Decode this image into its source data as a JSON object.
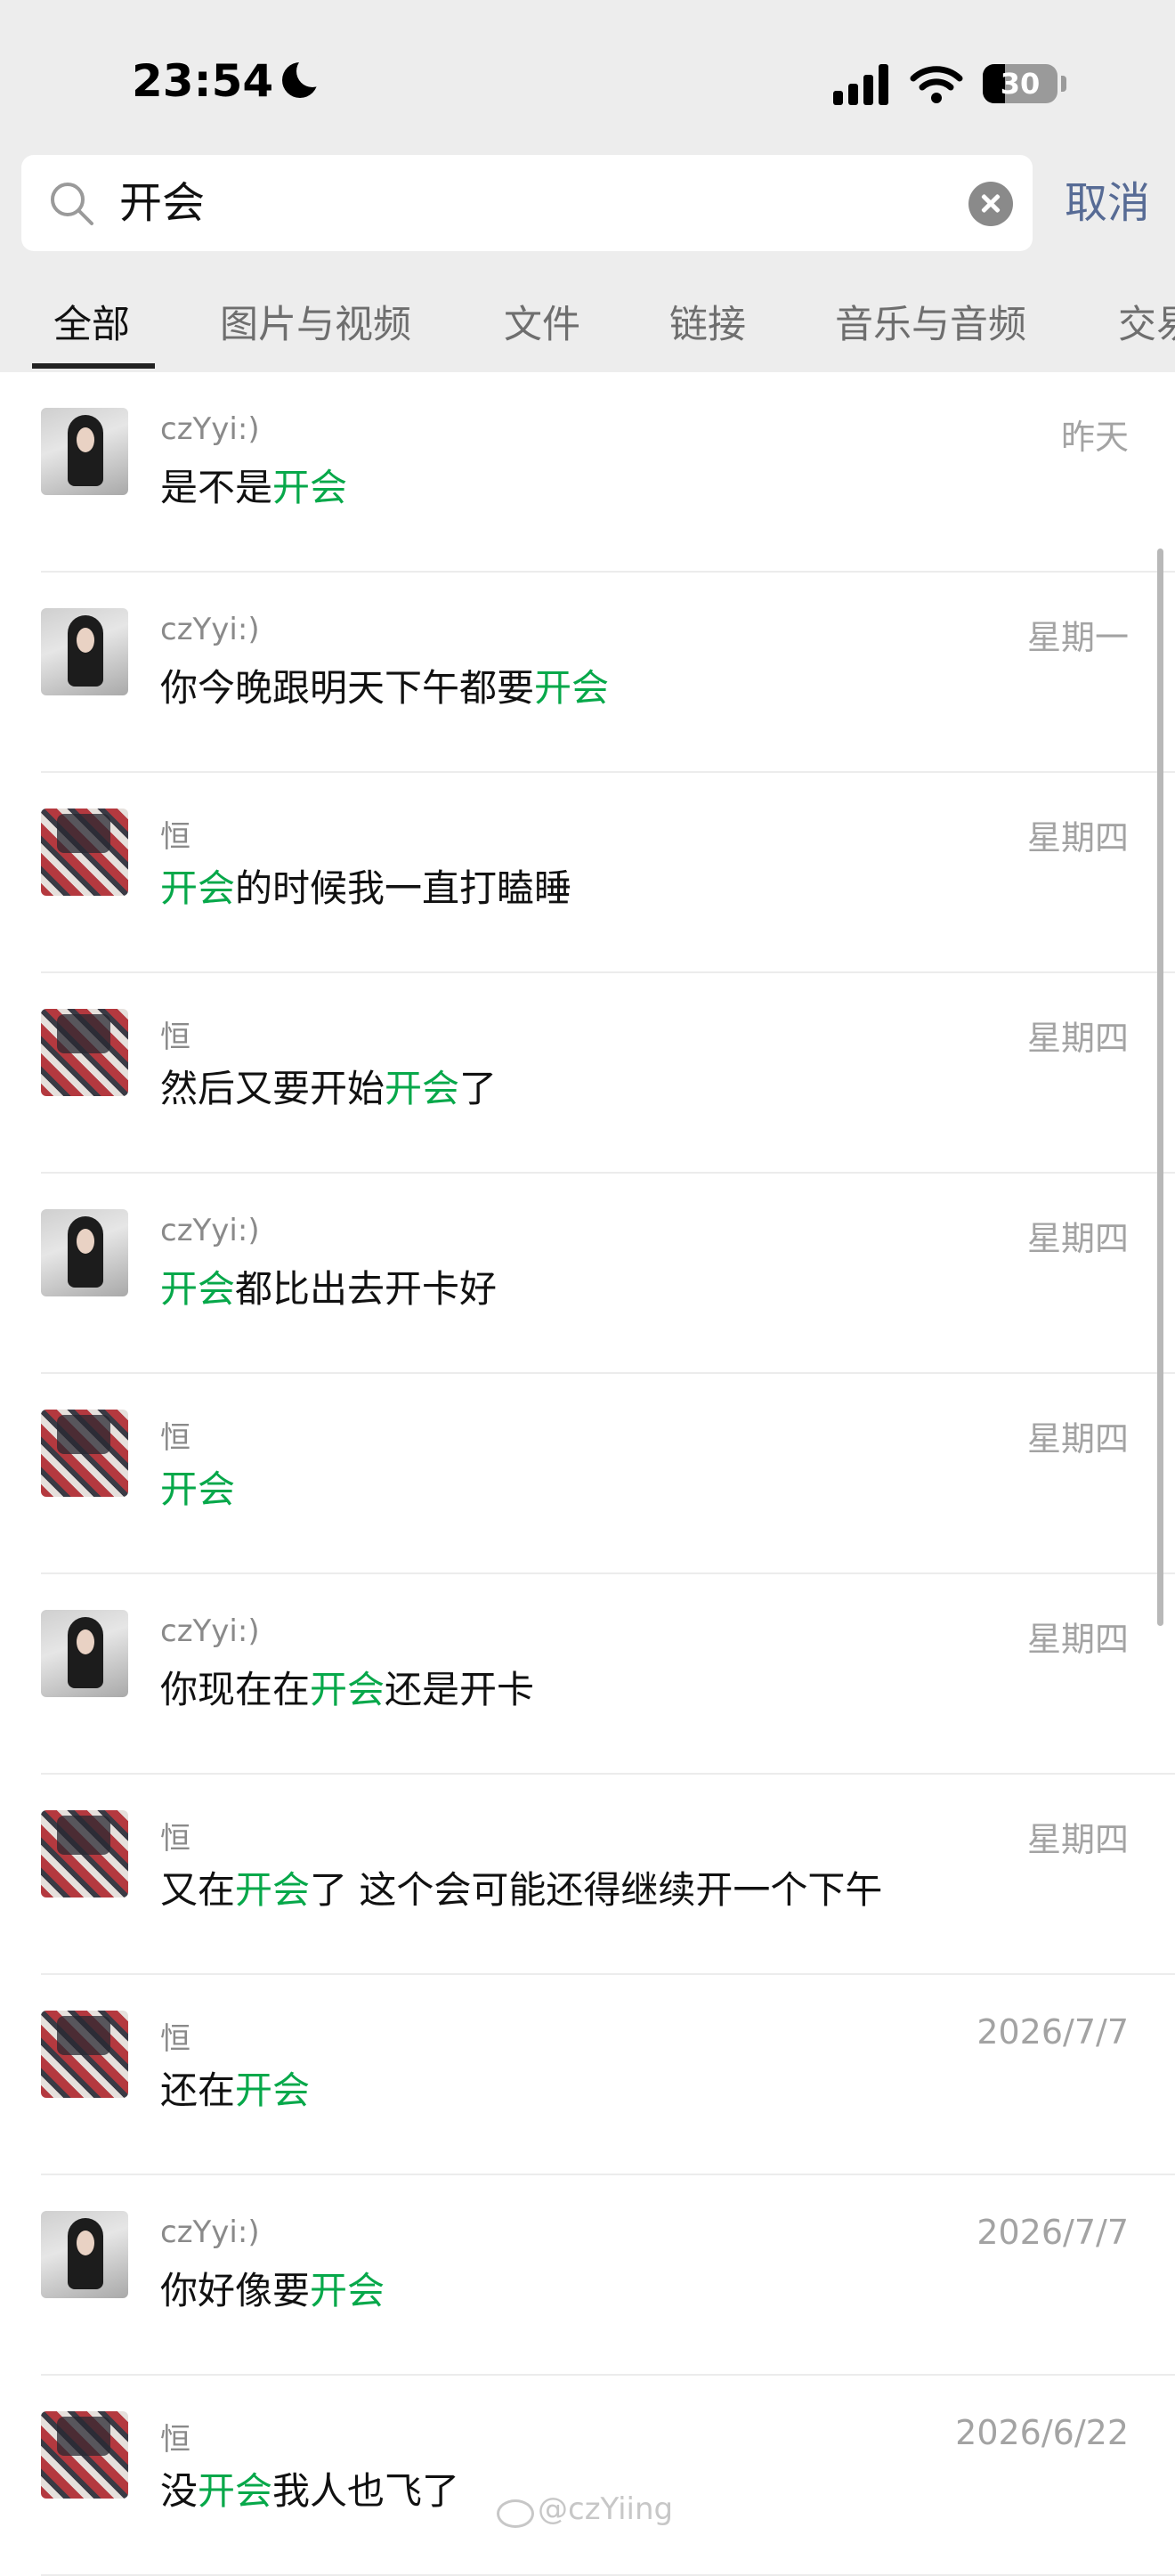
{
  "status_bar": {
    "time": "23:54",
    "battery": "30",
    "battery_level": 0.3
  },
  "search": {
    "query": "开会",
    "cancel_label": "取消"
  },
  "tabs": [
    {
      "label": "全部",
      "active": true
    },
    {
      "label": "图片与视频"
    },
    {
      "label": "文件"
    },
    {
      "label": "链接"
    },
    {
      "label": "音乐与音频"
    },
    {
      "label": "交易"
    }
  ],
  "results": [
    {
      "name": "czYyi:)",
      "date": "昨天",
      "avatar": "girl",
      "pre": "是不是",
      "hl": "开会",
      "post": ""
    },
    {
      "name": "czYyi:)",
      "date": "星期一",
      "avatar": "girl",
      "pre": "你今晚跟明天下午都要",
      "hl": "开会",
      "post": ""
    },
    {
      "name": "恒",
      "date": "星期四",
      "avatar": "man",
      "pre": "",
      "hl": "开会",
      "post": "的时候我一直打瞌睡"
    },
    {
      "name": "恒",
      "date": "星期四",
      "avatar": "man",
      "pre": "然后又要开始",
      "hl": "开会",
      "post": "了"
    },
    {
      "name": "czYyi:)",
      "date": "星期四",
      "avatar": "girl",
      "pre": "",
      "hl": "开会",
      "post": "都比出去开卡好"
    },
    {
      "name": "恒",
      "date": "星期四",
      "avatar": "man",
      "pre": "",
      "hl": "开会",
      "post": ""
    },
    {
      "name": "czYyi:)",
      "date": "星期四",
      "avatar": "girl",
      "pre": "你现在在",
      "hl": "开会",
      "post": "还是开卡"
    },
    {
      "name": "恒",
      "date": "星期四",
      "avatar": "man",
      "pre": "又在",
      "hl": "开会",
      "post": "了 这个会可能还得继续开一个下午"
    },
    {
      "name": "恒",
      "date": "2026/7/7",
      "avatar": "man",
      "pre": "还在",
      "hl": "开会",
      "post": ""
    },
    {
      "name": "czYyi:)",
      "date": "2026/7/7",
      "avatar": "girl",
      "pre": "你好像要",
      "hl": "开会",
      "post": ""
    },
    {
      "name": "恒",
      "date": "2026/6/22",
      "avatar": "man",
      "pre": "没",
      "hl": "开会",
      "post": "我人也飞了"
    }
  ],
  "watermark": "@czYiing",
  "colors": {
    "highlight": "#07a84a",
    "link": "#576b95"
  }
}
